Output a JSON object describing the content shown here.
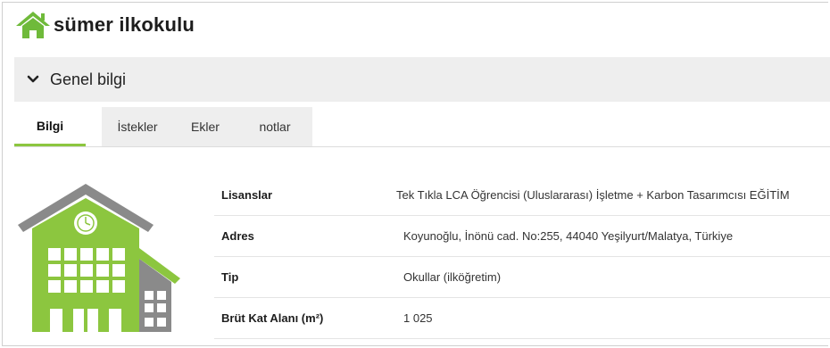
{
  "header": {
    "title": "sümer ilkokulu",
    "icon": "home-icon",
    "accent": "#6fba3a"
  },
  "section": {
    "label": "Genel bilgi",
    "icon": "chevron-down-icon"
  },
  "tabs": [
    {
      "label": "Bilgi",
      "active": true
    },
    {
      "label": "İstekler",
      "active": false
    },
    {
      "label": "Ekler",
      "active": false
    },
    {
      "label": "notlar",
      "active": false
    }
  ],
  "details": {
    "rows": [
      {
        "key": "Lisanslar",
        "value": "Tek Tıkla LCA Öğrencisi (Uluslararası) İşletme + Karbon Tasarımcısı EĞİTİM"
      },
      {
        "key": "Adres",
        "value": "Koyunoğlu, İnönü cad. No:255, 44040 Yeşilyurt/Malatya, Türkiye"
      },
      {
        "key": "Tip",
        "value": "Okullar (ilköğretim)"
      },
      {
        "key": "Brüt Kat Alanı (m²)",
        "value": "1 025"
      }
    ]
  },
  "colors": {
    "green": "#8cc63f",
    "gray": "#8a8a8a",
    "tab_bg": "#eeeeee"
  }
}
